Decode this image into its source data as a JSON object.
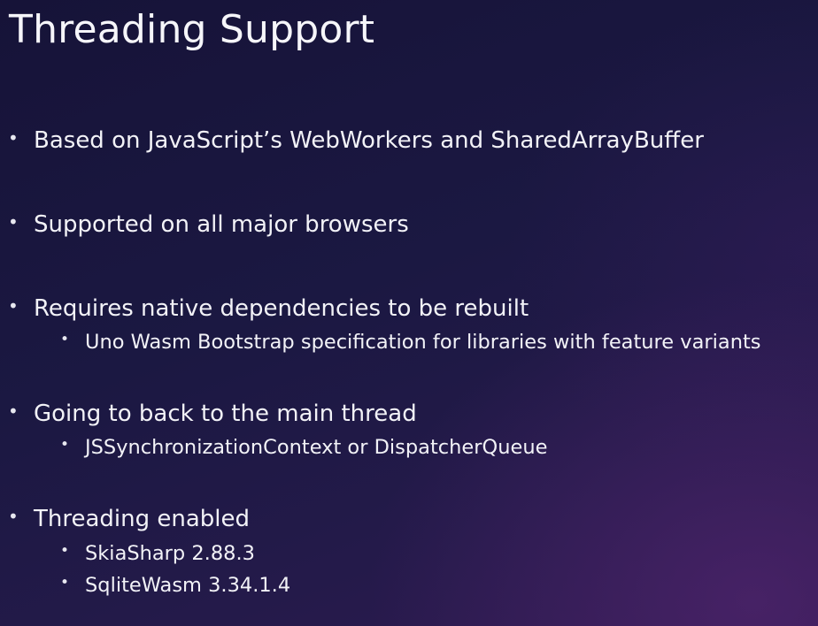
{
  "slide": {
    "title": "Threading Support",
    "bullets": [
      "Based on JavaScript’s WebWorkers and SharedArrayBuffer",
      "Supported on all major browsers",
      "Requires native dependencies to be rebuilt",
      "Uno Wasm Bootstrap specification for libraries with feature variants",
      "Going to back to the main thread",
      "JSSynchronizationContext or DispatcherQueue",
      "Threading enabled",
      "SkiaSharp 2.88.3",
      "SqliteWasm 3.34.1.4"
    ],
    "bullet_marker": "•"
  }
}
